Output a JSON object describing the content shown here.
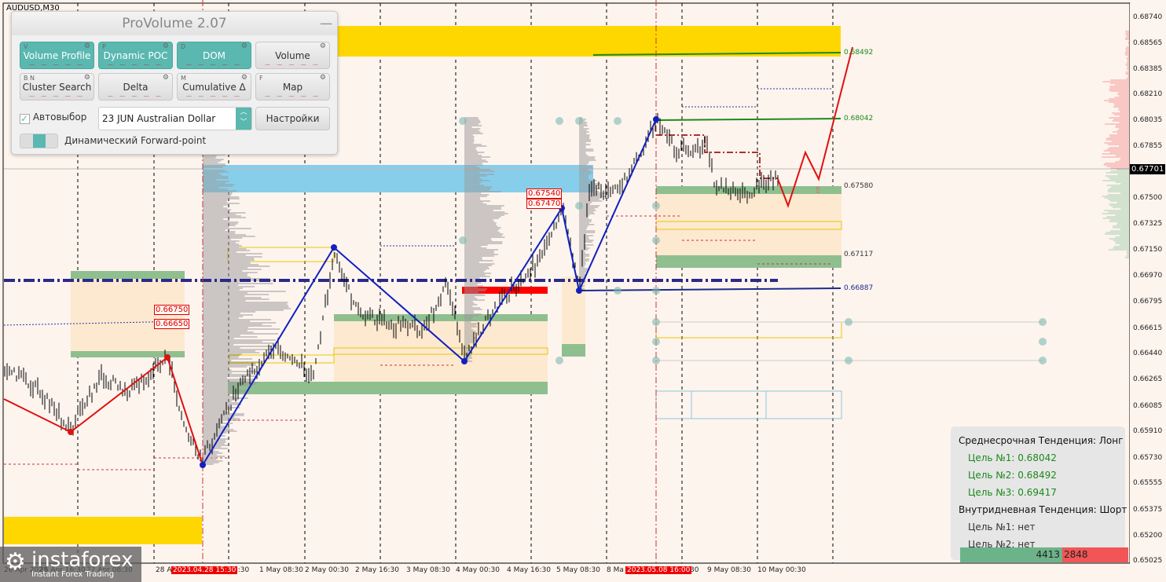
{
  "symbol": "AUDUSD,M30",
  "panel": {
    "title": "ProVolume 2.07",
    "minimize": "—",
    "buttons": [
      {
        "key": "V",
        "label": "Volume Profile",
        "active": true
      },
      {
        "key": "P",
        "label": "Dynamic POC",
        "active": true
      },
      {
        "key": "D",
        "label": "DOM",
        "active": true
      },
      {
        "key": "",
        "label": "Volume",
        "active": false
      },
      {
        "key": "B  N",
        "label": "Cluster Search",
        "active": false
      },
      {
        "key": "",
        "label": "Delta",
        "active": false
      },
      {
        "key": "M",
        "label": "Cumulative Δ",
        "active": false
      },
      {
        "key": "F",
        "label": "Map",
        "active": false
      }
    ],
    "autoselect_label": "Автовыбор",
    "autoselect_checked": true,
    "instrument": "23 JUN Australian Dollar",
    "settings_label": "Настройки",
    "forward_label": "Динамический Forward-point"
  },
  "price_axis": [
    "0.68740",
    "0.68565",
    "0.68385",
    "0.68210",
    "0.68035",
    "0.67855",
    "0.67500",
    "0.67325",
    "0.67150",
    "0.66970",
    "0.66795",
    "0.66615",
    "0.66440",
    "0.66265",
    "0.66085",
    "0.65910",
    "0.65730",
    "0.65555",
    "0.65375",
    "0.65200",
    "0.65025"
  ],
  "current_price": "0.67701",
  "time_axis": [
    "26 Apr 2023",
    "26 Apr 16:30",
    "27 Apr 08:30",
    "28 A",
    "6:30",
    "1 May 08:30",
    "2 May 00:30",
    "2 May 16:30",
    "3 May 08:30",
    "4 May 00:30",
    "4 May 16:30",
    "5 May 08:30",
    "8 Ma",
    ":30",
    "9 May 08:30",
    "10 May 00:30"
  ],
  "time_markers": [
    "2023.04.28 15:30",
    "2023.05.08 16:00"
  ],
  "levels": {
    "t2": "0.68492",
    "t1": "0.68042",
    "z1": "0.67580",
    "z2": "0.67117",
    "pivot": "0.66887"
  },
  "red_labels": [
    "0.66750",
    "0.66650",
    "0.67540",
    "0.67470"
  ],
  "info": {
    "mid": "Среднесрочная Тенденция: Лонг",
    "m1": "Цель №1: 0.68042",
    "m2": "Цель №2: 0.68492",
    "m3": "Цель №3: 0.69417",
    "intra": "Внутридневная Тенденция: Шорт",
    "i1": "Цель №1: нет",
    "i2": "Цель №2: нет"
  },
  "dom": {
    "buy": "4413",
    "sell": "2848"
  },
  "logo": {
    "name": "instaforex",
    "tagline": "Instant Forex Trading"
  },
  "colors": {
    "bg": "#fdf4ee",
    "accent": "#5ab8b0",
    "target": "#1a8a1a",
    "zigzag": "#1020c0",
    "forecast": "#e01010"
  }
}
